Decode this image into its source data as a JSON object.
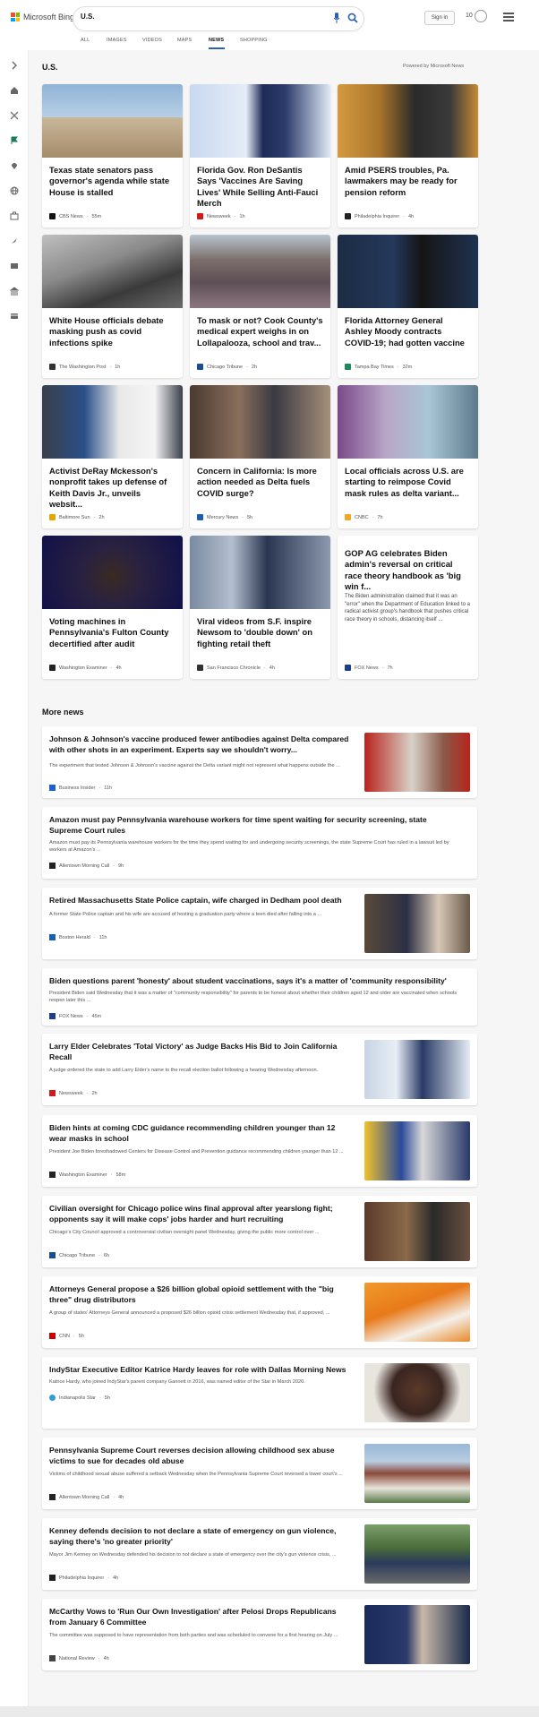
{
  "header": {
    "logo_text": "Microsoft Bing",
    "search_value": "U.S.",
    "signin_label": "Sign in",
    "rewards_count": "10"
  },
  "tabs": [
    "ALL",
    "IMAGES",
    "VIDEOS",
    "MAPS",
    "NEWS",
    "SHOPPING"
  ],
  "active_tab": "NEWS",
  "section": {
    "title": "U.S.",
    "powered_by": "Powered by Microsoft News"
  },
  "top_cards": [
    {
      "title": "Texas state senators pass governor's agenda while state House is stalled",
      "source": "CBS News",
      "age": "55m",
      "src_color": "#111111"
    },
    {
      "title": "Florida Gov. Ron DeSantis Says 'Vaccines Are Saving Lives' While Selling Anti-Fauci Merch",
      "source": "Newsweek",
      "age": "1h",
      "src_color": "#d11b1b"
    },
    {
      "title": "Amid PSERS troubles, Pa. lawmakers may be ready for pension reform",
      "source": "Philadelphia Inquirer",
      "age": "4h",
      "src_color": "#222222"
    },
    {
      "title": "White House officials debate masking push as covid infections spike",
      "source": "The Washington Post",
      "age": "1h",
      "src_color": "#333333"
    },
    {
      "title": "To mask or not? Cook County's medical expert weighs in on Lollapalooza, school and trav...",
      "source": "Chicago Tribune",
      "age": "2h",
      "src_color": "#1a4d8c"
    },
    {
      "title": "Florida Attorney General Ashley Moody contracts COVID-19; had gotten vaccine",
      "source": "Tampa Bay Times",
      "age": "32m",
      "src_color": "#1b8a5a"
    },
    {
      "title": "Activist DeRay Mckesson's nonprofit takes up defense of Keith Davis Jr., unveils websit...",
      "source": "Baltimore Sun",
      "age": "2h",
      "src_color": "#e6a600"
    },
    {
      "title": "Concern in California: Is more action needed as Delta fuels COVID surge?",
      "source": "Mercury News",
      "age": "5h",
      "src_color": "#1a5fb4"
    },
    {
      "title": "Local officials across U.S. are starting to reimpose Covid mask rules as delta variant...",
      "source": "CNBC",
      "age": "7h",
      "src_color": "#f5a623"
    },
    {
      "title": "Voting machines in Pennsylvania's Fulton County decertified after audit",
      "source": "Washington Examiner",
      "age": "4h",
      "src_color": "#222222"
    },
    {
      "title": "Viral videos from S.F. inspire Newsom to 'double down' on fighting retail theft",
      "source": "San Francisco Chronicle",
      "age": "4h",
      "src_color": "#333333"
    },
    {
      "title": "GOP AG celebrates Biden admin's reversal on critical race theory handbook as 'big win f...",
      "snippet": "The Biden administration claimed that it was an \"error\" when the Department of Education linked to a radical activist group's handbook that pushes critical race theory in schools, distancing itself ...",
      "source": "FOX News",
      "age": "7h",
      "src_color": "#1d3f8a"
    }
  ],
  "more_news_title": "More news",
  "more_news": [
    {
      "title": "Johnson & Johnson's vaccine produced fewer antibodies against Delta compared with other shots in an experiment. Experts say we shouldn't worry...",
      "snippet": "The experiment that tested Johnson & Johnson's vaccine against the Delta variant might not represent what happens outside the ...",
      "source": "Business Insider",
      "age": "11h",
      "src_color": "#1a5fd6"
    },
    {
      "title": "Amazon must pay Pennsylvania warehouse workers for time spent waiting for security screening, state Supreme Court rules",
      "snippet": "Amazon must pay its Pennsylvania warehouse workers for the time they spend waiting for and undergoing security screenings, the state Supreme Court has ruled in a lawsuit led by workers at Amazon's ...",
      "source": "Allentown Morning Call",
      "age": "9h",
      "src_color": "#222222"
    },
    {
      "title": "Retired Massachusetts State Police captain, wife charged in Dedham pool death",
      "snippet": "A former State Police captain and his wife are accused of hosting a graduation party where a teen died after falling into a ...",
      "source": "Boston Herald",
      "age": "11h",
      "src_color": "#1a5fb4"
    },
    {
      "title": "Biden questions parent 'honesty' about student vaccinations, says it's a matter of 'community responsibility'",
      "snippet": "President Biden said Wednesday that it was a matter of \"community responsibility\" for parents to be honest about whether their children aged 12 and older are vaccinated when schools reopen later this ...",
      "source": "FOX News",
      "age": "45m",
      "src_color": "#1d3f8a"
    },
    {
      "title": "Larry Elder Celebrates 'Total Victory' as Judge Backs His Bid to Join California Recall",
      "snippet": "A judge ordered the state to add Larry Elder's name to the recall election ballot following a hearing Wednesday afternoon.",
      "source": "Newsweek",
      "age": "2h",
      "src_color": "#d11b1b"
    },
    {
      "title": "Biden hints at coming CDC guidance recommending children younger than 12 wear masks in school",
      "snippet": "President Joe Biden foreshadowed Centers for Disease Control and Prevention guidance recommending children younger than 12 ...",
      "source": "Washington Examiner",
      "age": "58m",
      "src_color": "#222222"
    },
    {
      "title": "Civilian oversight for Chicago police wins final approval after yearslong fight; opponents say it will make cops' jobs harder and hurt recruiting",
      "snippet": "Chicago's City Council approved a controversial civilian oversight panel Wednesday, giving the public more control over ...",
      "source": "Chicago Tribune",
      "age": "6h",
      "src_color": "#1a4d8c"
    },
    {
      "title": "Attorneys General propose a $26 billion global opioid settlement with the \"big three\" drug distributors",
      "snippet": "A group of states' Attorneys General announced a proposed $26 billion opioid crisis settlement Wednesday that, if approved, ...",
      "source": "CNN",
      "age": "5h",
      "src_color": "#cc0000"
    },
    {
      "title": "IndyStar Executive Editor Katrice Hardy leaves for role with Dallas Morning News",
      "snippet": "Katrice Hardy, who joined IndyStar's parent company Gannett in 2016, was named editor of the Star in March 2020.",
      "source": "Indianapolis Star",
      "age": "5h",
      "src_color": "#2d9cdb"
    },
    {
      "title": "Pennsylvania Supreme Court reverses decision allowing childhood sex abuse victims to sue for decades old abuse",
      "snippet": "Victims of childhood sexual abuse suffered a setback Wednesday when the Pennsylvania Supreme Court reversed a lower court's ...",
      "source": "Allentown Morning Call",
      "age": "4h",
      "src_color": "#222222"
    },
    {
      "title": "Kenney defends decision to not declare a state of emergency on gun violence, saying there's 'no greater priority'",
      "snippet": "Mayor Jim Kenney on Wednesday defended his decision to not declare a state of emergency over the city's gun violence crisis, ...",
      "source": "Philadelphia Inquirer",
      "age": "4h",
      "src_color": "#222222"
    },
    {
      "title": "McCarthy Vows to 'Run Our Own Investigation' after Pelosi Drops Republicans from January 6 Committee",
      "snippet": "The committee was supposed to have representation from both parties and was scheduled to convene for a first hearing on July ...",
      "source": "National Review",
      "age": "4h",
      "src_color": "#444444"
    }
  ]
}
